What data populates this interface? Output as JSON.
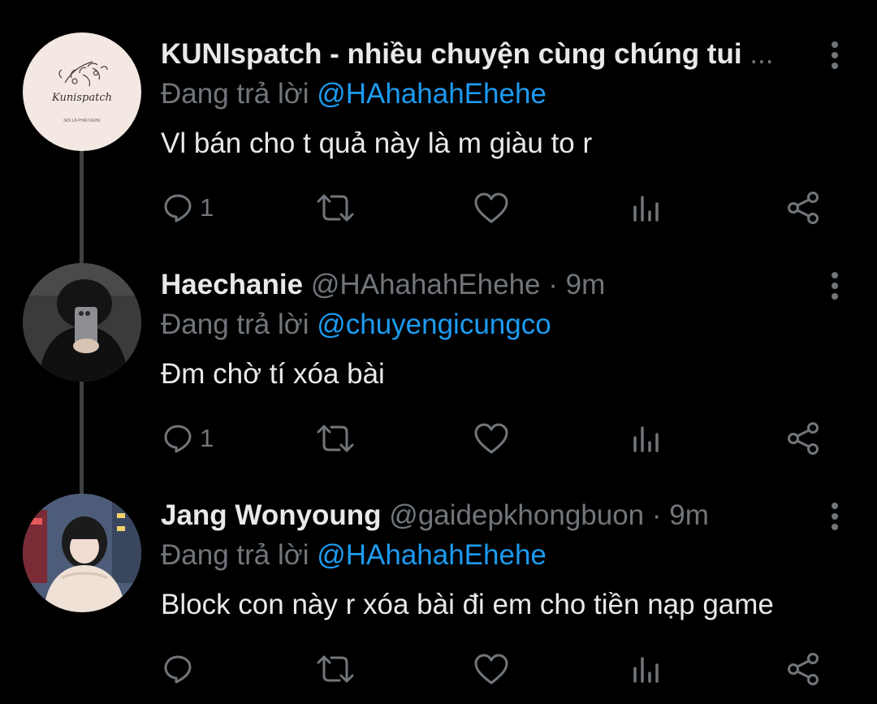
{
  "colors": {
    "background": "#000000",
    "text_primary": "#e7e9ea",
    "text_secondary": "#71767b",
    "link": "#1d9bf0",
    "thread_line": "#3e4144"
  },
  "tweets": [
    {
      "display_name": "KUNIspatch - nhiều chuyện cùng chúng tui",
      "truncated_suffix": "...",
      "handle": "",
      "time": "",
      "reply_prefix": "Đang trả lời",
      "reply_to": "@HAhahahEhehe",
      "text": "Vl bán cho t quả này là m giàu to r",
      "reply_count": "1",
      "avatar_logo": {
        "script": "Kunispatch",
        "tagline": "NÓI LÀ PHẢI NGHE"
      }
    },
    {
      "display_name": "Haechanie",
      "handle": "@HAhahahEhehe",
      "separator": "·",
      "time": "9m",
      "reply_prefix": "Đang trả lời",
      "reply_to": "@chuyengicungco",
      "text": "Đm chờ tí xóa bài",
      "reply_count": "1"
    },
    {
      "display_name": "Jang Wonyoung",
      "handle": "@gaidepkhongbuon",
      "separator": "·",
      "time": "9m",
      "reply_prefix": "Đang trả lời",
      "reply_to": "@HAhahahEhehe",
      "text": "Block con này r xóa bài đi em cho tiền nạp game",
      "reply_count": ""
    }
  ],
  "icons": {
    "reply": "reply-icon",
    "retweet": "retweet-icon",
    "like": "heart-icon",
    "views": "analytics-icon",
    "share": "share-icon",
    "more": "more-vertical-icon"
  }
}
